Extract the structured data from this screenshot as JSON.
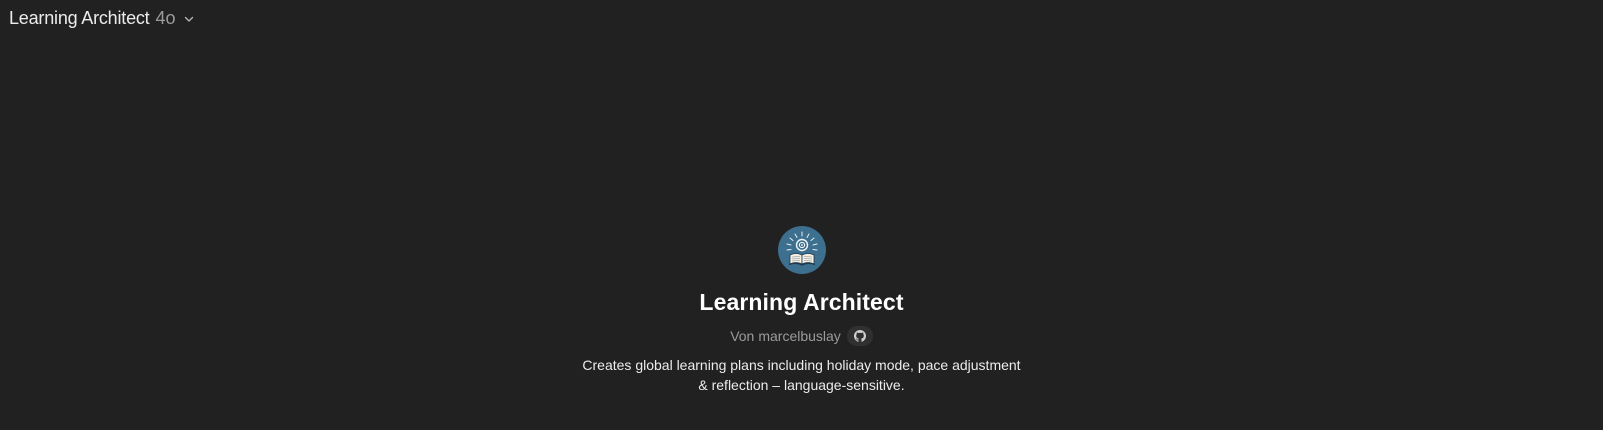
{
  "header": {
    "model_name": "Learning Architect",
    "model_version": "4o",
    "chevron_icon": "chevron-down-icon"
  },
  "gpt": {
    "avatar_icon": "open-book-lightbulb-icon",
    "title": "Learning Architect",
    "author_prefix": "Von",
    "author": "marcelbuslay",
    "author_badge_icon": "github-icon",
    "description_line1": "Creates global learning plans including holiday mode, pace adjustment",
    "description_line2": "& reflection – language-sensitive."
  },
  "colors": {
    "background": "#212121",
    "avatar_bg": "#3d6f8e",
    "muted_text": "#9b9b9b",
    "primary_text": "#ececec"
  }
}
